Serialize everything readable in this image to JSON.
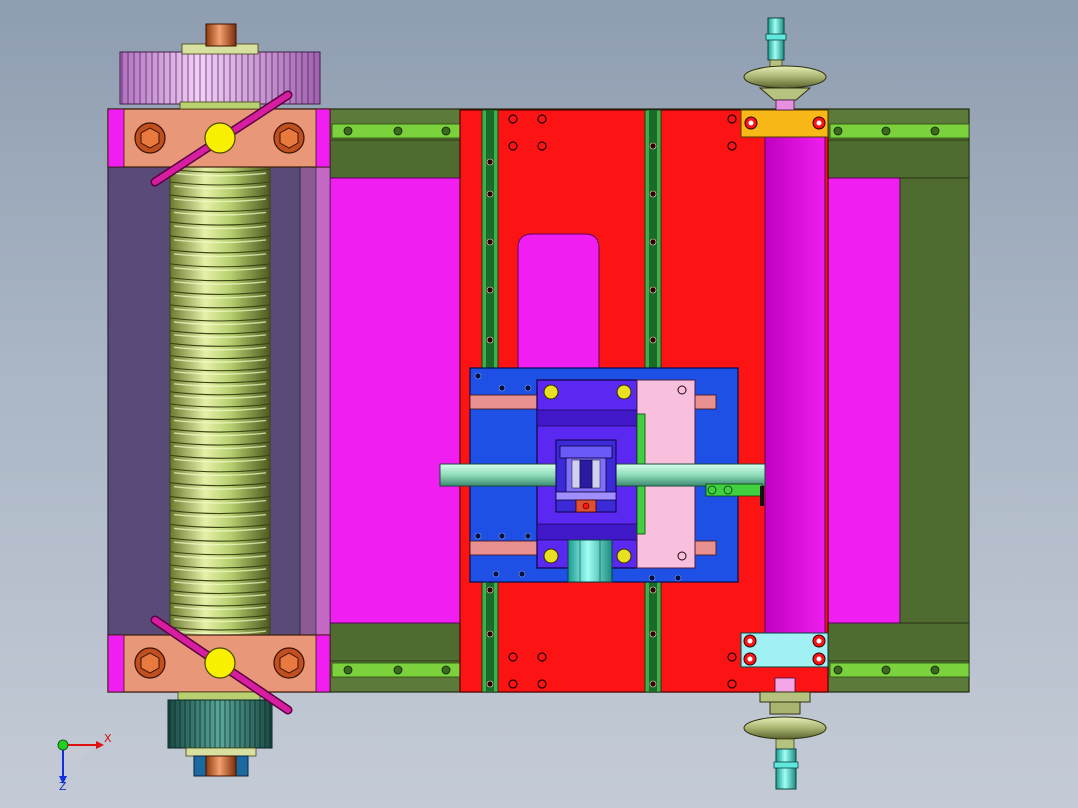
{
  "view": {
    "axes": {
      "x_label": "X",
      "z_label": "Z"
    }
  },
  "colors": {
    "background_top": "#8e9db0",
    "background_bottom": "#c4cbd6",
    "base_plate": "#5c7a3a",
    "mold_frame_red": "#fc1414",
    "cavity_magenta": "#f01ef0",
    "screw_shaft": "#b8d070",
    "gear": "#e8a8f0",
    "block_salmon": "#e89878",
    "slider_blue": "#1e50e6",
    "core_violet": "#5a28f0",
    "insert_pink": "#f8c0dc",
    "pin_green": "#8edcb8",
    "handwheel": "#b6c280",
    "handle_cyan": "#3ce0d0",
    "bracket_orange": "#f8b818",
    "clamp_cyan": "#a0f0f4",
    "lever_magenta": "#d81ea0",
    "knob_yellow": "#f8f000"
  }
}
